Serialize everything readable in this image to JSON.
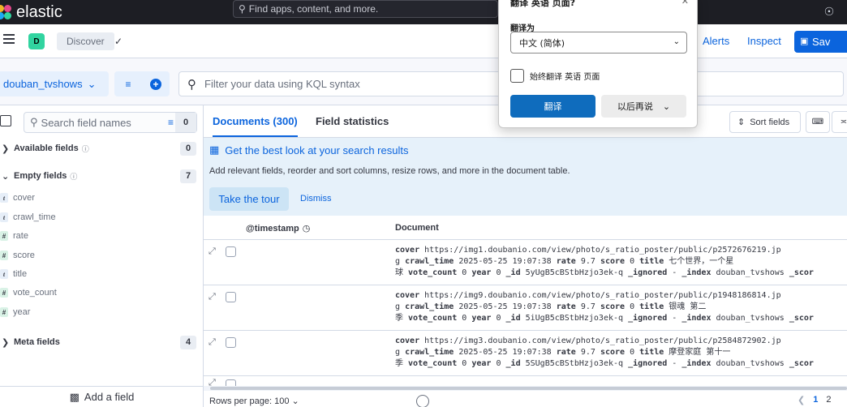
{
  "header": {
    "brand": "elastic",
    "search_placeholder": "Find apps, content, and more."
  },
  "appbar": {
    "space_initial": "D",
    "breadcrumb": "Discover",
    "alerts": "Alerts",
    "inspect": "Inspect",
    "save": "Sav"
  },
  "querybar": {
    "dataview": "douban_tvshows",
    "kql_placeholder": "Filter your data using KQL syntax"
  },
  "sidebar": {
    "search_placeholder": "Search field names",
    "filter_count": "0",
    "groups": [
      {
        "label": "Available fields",
        "count": "0"
      },
      {
        "label": "Empty fields",
        "count": "7"
      },
      {
        "label": "Meta fields",
        "count": "4"
      }
    ],
    "fields": [
      {
        "name": "cover",
        "type": "t"
      },
      {
        "name": "crawl_time",
        "type": "t"
      },
      {
        "name": "rate",
        "type": "#"
      },
      {
        "name": "score",
        "type": "#"
      },
      {
        "name": "title",
        "type": "t"
      },
      {
        "name": "vote_count",
        "type": "#"
      },
      {
        "name": "year",
        "type": "#"
      }
    ],
    "add_field": "Add a field"
  },
  "main": {
    "tabs": [
      "Documents (300)",
      "Field statistics"
    ],
    "sort_fields": "Sort fields",
    "callout": {
      "title": "Get the best look at your search results",
      "text": "Add relevant fields, reorder and sort columns, resize rows, and more in the document table.",
      "tour": "Take the tour",
      "dismiss": "Dismiss"
    },
    "columns": [
      "@timestamp",
      "Document"
    ],
    "rows": [
      {
        "cover_url": "https://img1.doubanio.com/view/photo/s_ratio_poster/public/p2572676219.jp",
        "cover_tail": "g",
        "crawl_time": "2025-05-25 19:07:38",
        "rate": "9.7",
        "score": "0",
        "title_a": "七个世界，一个星",
        "title_b": "球",
        "vote_count": "0",
        "year": "0",
        "id": "5yUgB5cBStbHzjo3ek-q",
        "ignored": "-",
        "index": "douban_tvshows",
        "score_tail": "_scor"
      },
      {
        "cover_url": "https://img9.doubanio.com/view/photo/s_ratio_poster/public/p1948186814.jp",
        "cover_tail": "g",
        "crawl_time": "2025-05-25 19:07:38",
        "rate": "9.7",
        "score": "0",
        "title_a": "银魂 第二",
        "title_b": "季",
        "vote_count": "0",
        "year": "0",
        "id": "5iUgB5cBStbHzjo3ek-q",
        "ignored": "-",
        "index": "douban_tvshows",
        "score_tail": "_scor"
      },
      {
        "cover_url": "https://img3.doubanio.com/view/photo/s_ratio_poster/public/p2584872902.jp",
        "cover_tail": "g",
        "crawl_time": "2025-05-25 19:07:38",
        "rate": "9.7",
        "score": "0",
        "title_a": "摩登家庭 第十一",
        "title_b": "季",
        "vote_count": "0",
        "year": "0",
        "id": "5SUgB5cBStbHzjo3ek-q",
        "ignored": "-",
        "index": "douban_tvshows",
        "score_tail": "_scor"
      }
    ],
    "footer": {
      "rows_per_page": "Rows per page: 100",
      "page1": "1",
      "page2": "2"
    }
  },
  "translate_popup": {
    "title": "翻译 英语 页面?",
    "translate_to_label": "翻译为",
    "target_language": "中文 (简体)",
    "always_translate": "始终翻译 英语 页面",
    "translate_button": "翻译",
    "later_button": "以后再说"
  },
  "colors": {
    "accent": "#0b64dd",
    "topbar": "#1d1e24",
    "callout_bg": "#e6f1fa"
  }
}
